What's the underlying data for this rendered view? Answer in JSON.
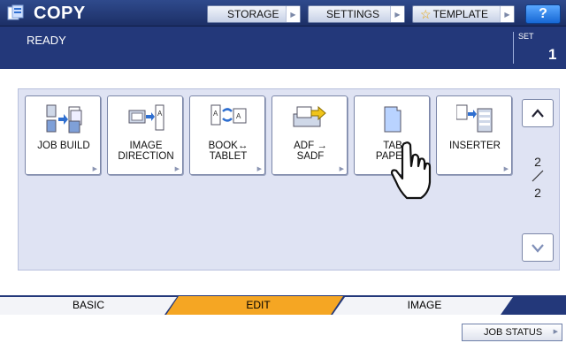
{
  "header": {
    "title": "COPY",
    "storage_label": "STORAGE",
    "settings_label": "SETTINGS",
    "template_label": "TEMPLATE",
    "help_label": "?"
  },
  "status": {
    "text": "READY",
    "set_label": "SET",
    "set_value": "1"
  },
  "functions": [
    {
      "label": "JOB BUILD",
      "icon": "job-build-icon"
    },
    {
      "label": "IMAGE\nDIRECTION",
      "icon": "image-direction-icon"
    },
    {
      "label": "BOOK↔\nTABLET",
      "icon": "book-tablet-icon"
    },
    {
      "label": "ADF →\nSADF",
      "icon": "adf-sadf-icon"
    },
    {
      "label": "TAB\nPAPER",
      "icon": "tab-paper-icon"
    },
    {
      "label": "INSERTER",
      "icon": "inserter-icon"
    }
  ],
  "pager": {
    "current": "2",
    "total": "2"
  },
  "tabs": [
    {
      "label": "BASIC",
      "active": false
    },
    {
      "label": "EDIT",
      "active": true
    },
    {
      "label": "IMAGE",
      "active": false
    }
  ],
  "footer": {
    "job_status_label": "JOB STATUS"
  },
  "colors": {
    "header_dark": "#1c2f66",
    "status_blue": "#23387a",
    "panel_bg": "#dfe3f3",
    "active_tab": "#f5a623",
    "help_blue": "#1667d4"
  }
}
